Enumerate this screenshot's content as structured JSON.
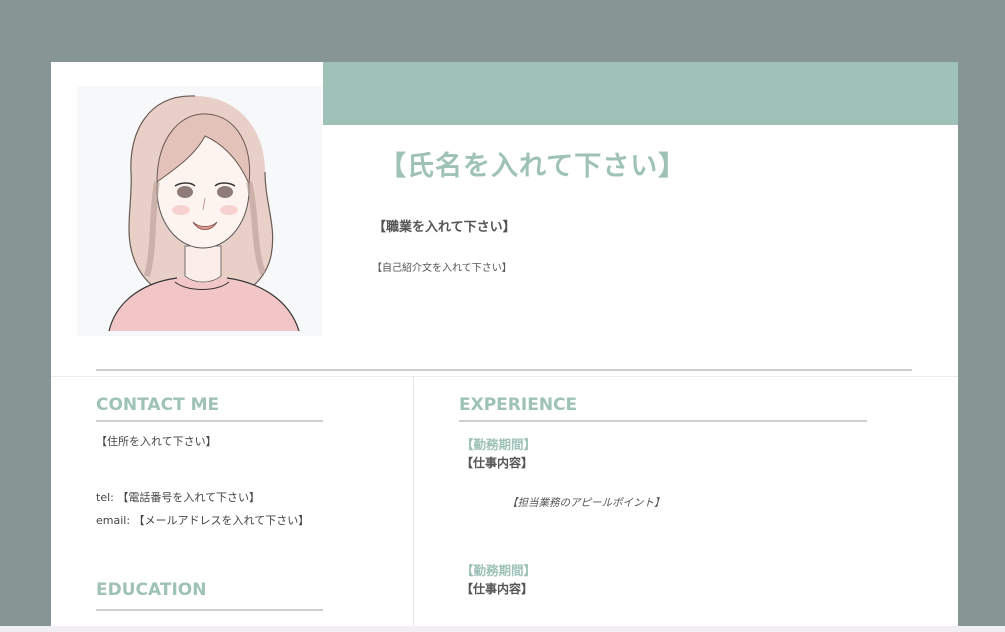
{
  "header": {
    "name": "【氏名を入れて下さい】",
    "occupation": "【職業を入れて下さい】",
    "intro": "【自己紹介文を入れて下さい】"
  },
  "contact": {
    "title": "CONTACT ME",
    "address": "【住所を入れて下さい】",
    "tel": "tel: 【電話番号を入れて下さい】",
    "email": "email: 【メールアドレスを入れて下さい】"
  },
  "education": {
    "title": "EDUCATION"
  },
  "experience": {
    "title": "EXPERIENCE",
    "items": [
      {
        "period": "【勤務期間】",
        "job": "【仕事内容】",
        "appeal": "【担当業務のアピールポイント】"
      },
      {
        "period": "【勤務期間】",
        "job": "【仕事内容】"
      }
    ]
  },
  "colors": {
    "background": "#879695",
    "accent": "#9fc2b8",
    "page": "#ffffff",
    "text": "#555555"
  },
  "icons": [
    "portrait-illustration"
  ]
}
